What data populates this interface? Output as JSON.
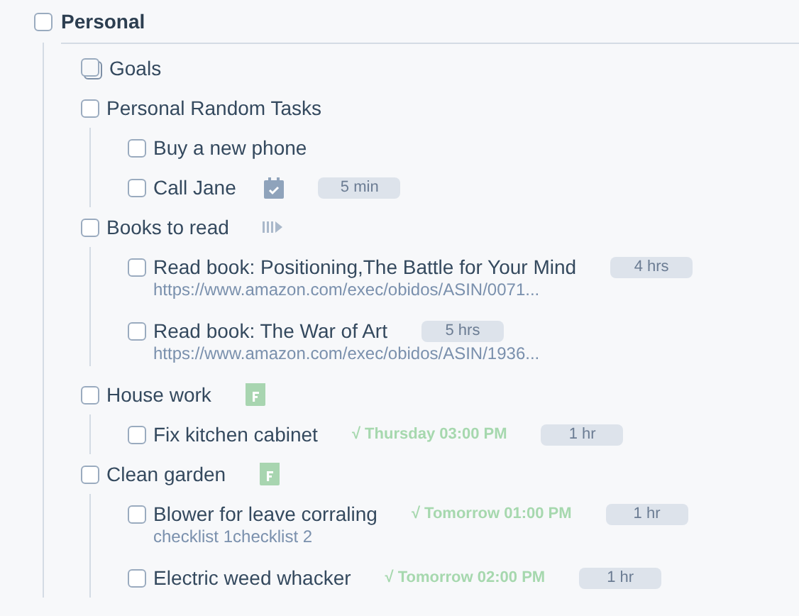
{
  "project": {
    "title": "Personal",
    "checked": false,
    "items": [
      {
        "title": "Goals",
        "kind": "goal",
        "checked": false
      },
      {
        "title": "Personal Random Tasks",
        "checked": false,
        "children": [
          {
            "title": "Buy a new phone",
            "checked": false
          },
          {
            "title": "Call Jane",
            "checked": false,
            "attachment": {
              "kind": "scheduled"
            },
            "duration": "5 min"
          }
        ]
      },
      {
        "title": "Books to read",
        "checked": false,
        "attachment": {
          "kind": "progress"
        },
        "children": [
          {
            "title": "Read book: Positioning,The Battle for Your Mind",
            "checked": false,
            "duration": "4 hrs",
            "note": "https://www.amazon.com/exec/obidos/ASIN/0071..."
          },
          {
            "title": "Read book: The War of Art",
            "checked": false,
            "duration": "5 hrs",
            "note": "https://www.amazon.com/exec/obidos/ASIN/1936..."
          }
        ]
      },
      {
        "title": "House work",
        "checked": false,
        "attachment": {
          "kind": "flagged"
        },
        "children": [
          {
            "title": "Fix kitchen cabinet",
            "checked": false,
            "due": "√ Thursday 03:00 PM",
            "duration": "1 hr"
          }
        ]
      },
      {
        "title": "Clean garden",
        "checked": false,
        "attachment": {
          "kind": "flagged"
        },
        "children": [
          {
            "title": "Blower for leave corraling",
            "checked": false,
            "due": "√ Tomorrow 01:00 PM",
            "duration": "1 hr",
            "note": "checklist 1checklist 2"
          },
          {
            "title": "Electric weed whacker",
            "checked": false,
            "due": "√ Tomorrow 02:00 PM",
            "duration": "1 hr"
          }
        ]
      }
    ]
  }
}
